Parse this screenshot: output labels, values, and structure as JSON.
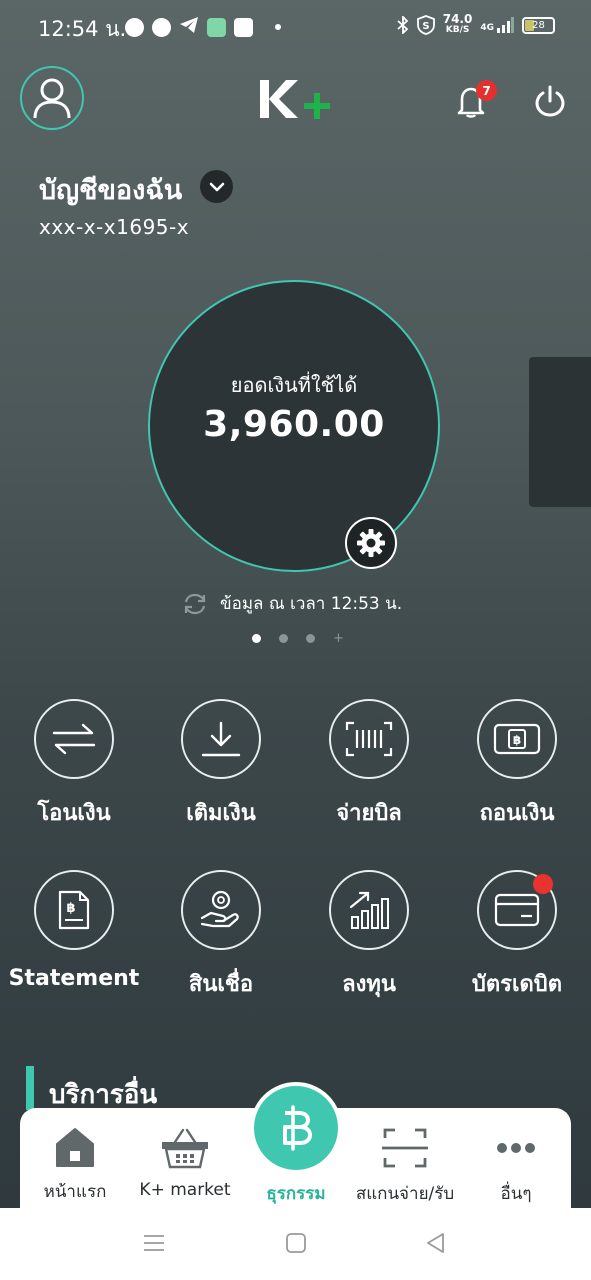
{
  "status_bar": {
    "time": "12:54 น.",
    "net_speed": "74.0",
    "net_unit": "KB/S",
    "signal_label": "4G",
    "battery": "28"
  },
  "header": {
    "notification_count": "7"
  },
  "account": {
    "name": "บัญชีของฉัน",
    "number": "xxx-x-x1695-x"
  },
  "balance": {
    "label": "ยอดเงินที่ใช้ได้",
    "value": "3,960.00",
    "updated": "ข้อมูล ณ เวลา 12:53 น."
  },
  "actions": [
    {
      "label": "โอนเงิน",
      "icon": "transfer-icon"
    },
    {
      "label": "เติมเงิน",
      "icon": "top-up-icon"
    },
    {
      "label": "จ่ายบิล",
      "icon": "barcode-icon"
    },
    {
      "label": "ถอนเงิน",
      "icon": "withdraw-icon"
    },
    {
      "label": "Statement",
      "icon": "statement-icon"
    },
    {
      "label": "สินเชื่อ",
      "icon": "loan-icon"
    },
    {
      "label": "ลงทุน",
      "icon": "invest-icon"
    },
    {
      "label": "บัตรเดบิต",
      "icon": "debit-card-icon"
    }
  ],
  "section": {
    "title": "บริการอื่น"
  },
  "bottom_nav": [
    {
      "label": "หน้าแรก",
      "icon": "home-icon"
    },
    {
      "label": "K+ market",
      "icon": "basket-icon"
    },
    {
      "label": "ธุรกรรม",
      "icon": "baht-icon"
    },
    {
      "label": "สแกนจ่าย/รับ",
      "icon": "scan-icon"
    },
    {
      "label": "อื่นๆ",
      "icon": "more-icon"
    }
  ],
  "colors": {
    "accent": "#3fc7b0",
    "logo_green": "#20b24a",
    "badge_red": "#e2312f"
  }
}
